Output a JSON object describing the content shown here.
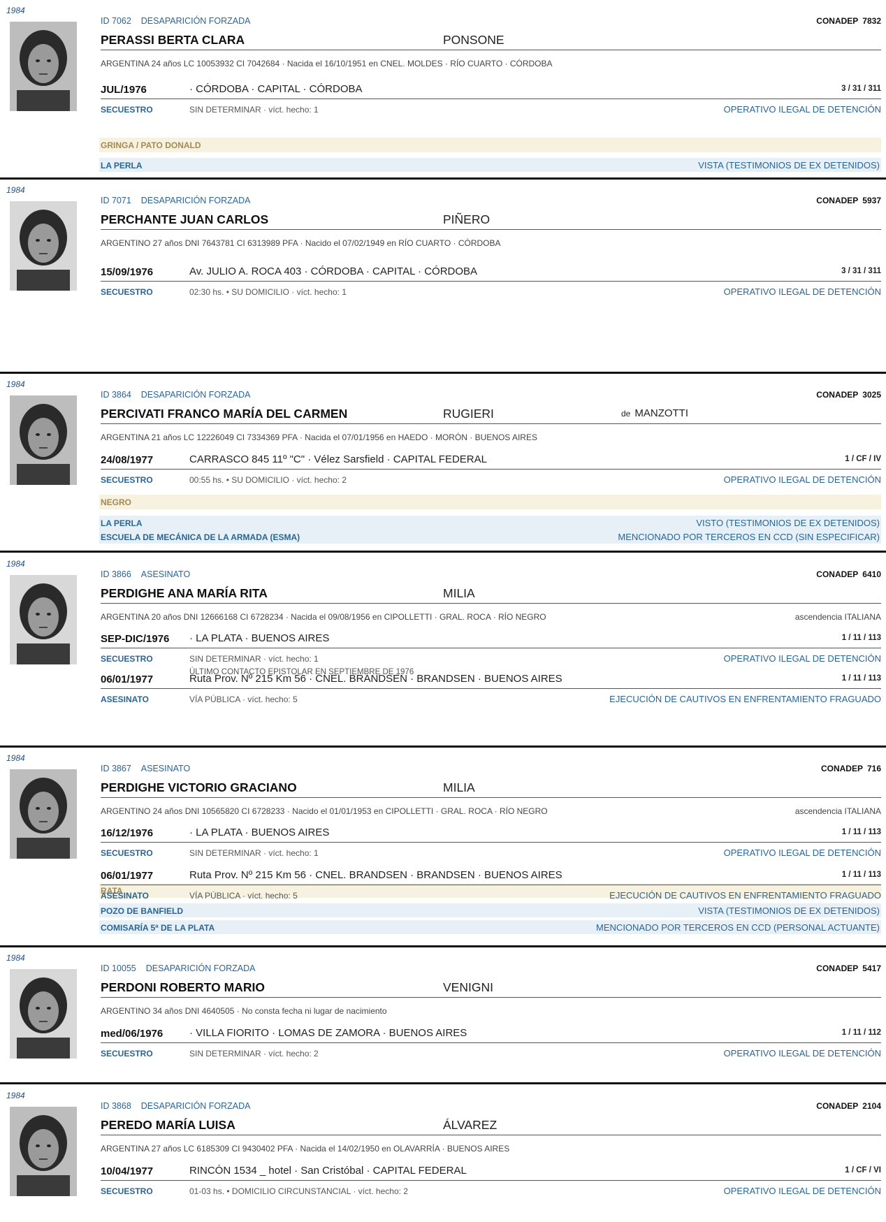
{
  "records": [
    {
      "year": "1984",
      "id": "ID 7062",
      "category": "DESAPARICIÓN FORZADA",
      "conadep_label": "CONADEP",
      "conadep_number": "7832",
      "surname_given": "PERASSI  BERTA CLARA",
      "mother_surname": "PONSONE",
      "personal": "ARGENTINA   24 años   LC 10053932   CI 7042684  ·  Nacida el 16/10/1951 en CNEL. MOLDES · RÍO CUARTO · CÓRDOBA",
      "events": [
        {
          "date": "JUL/1976",
          "place": "· CÓRDOBA · CAPITAL · CÓRDOBA",
          "code": "3 / 31 / 311",
          "type": "SECUESTRO",
          "detail": "SIN DETERMINAR  ·  víct. hecho: 1",
          "operation": "OPERATIVO ILEGAL DE DETENCIÓN"
        }
      ],
      "alias": "GRINGA / PATO DONALD",
      "ccd": [
        {
          "name": "LA PERLA",
          "status": "VISTA (TESTIMONIOS DE EX DETENIDOS)"
        }
      ]
    },
    {
      "year": "1984",
      "id": "ID 7071",
      "category": "DESAPARICIÓN FORZADA",
      "conadep_label": "CONADEP",
      "conadep_number": "5937",
      "surname_given": "PERCHANTE  JUAN CARLOS",
      "mother_surname": "PIÑERO",
      "personal": "ARGENTINO   27 años   DNI 7643781   CI 6313989 PFA  ·  Nacido el 07/02/1949 en RÍO CUARTO · CÓRDOBA",
      "events": [
        {
          "date": "15/09/1976",
          "place": "Av. JULIO A. ROCA 403   ·   CÓRDOBA · CAPITAL · CÓRDOBA",
          "code": "3 / 31 / 311",
          "type": "SECUESTRO",
          "detail": "02:30 hs.  •  SU DOMICILIO  ·  víct. hecho: 1",
          "operation": "OPERATIVO ILEGAL DE DETENCIÓN"
        }
      ],
      "alias": "NEGRO",
      "ccd": [
        {
          "name": "LA PERLA",
          "status": "VISTO (TESTIMONIOS DE EX DETENIDOS)"
        },
        {
          "name": "ESCUELA DE MECÁNICA DE LA ARMADA (ESMA)",
          "status": "MENCIONADO POR TERCEROS EN CCD (SIN ESPECIFICAR)"
        }
      ]
    },
    {
      "year": "1984",
      "id": "ID 3864",
      "category": "DESAPARICIÓN FORZADA",
      "conadep_label": "CONADEP",
      "conadep_number": "3025",
      "surname_given": "PERCIVATI FRANCO  MARÍA DEL CARMEN",
      "mother_surname": "RUGIERI",
      "spouse_prefix": "de",
      "spouse_surname": "MANZOTTI",
      "personal": "ARGENTINA   21 años   LC 12226049   CI 7334369 PFA  ·  Nacida el 07/01/1956 en HAEDO · MORÓN · BUENOS AIRES",
      "events": [
        {
          "date": "24/08/1977",
          "place": "CARRASCO 845  11º \"C\"  ·  Vélez Sarsfield  ·  CAPITAL FEDERAL",
          "code": "1 / CF / IV",
          "type": "SECUESTRO",
          "detail": "00:55 hs.  •  SU DOMICILIO  ·  víct. hecho: 2",
          "operation": "OPERATIVO ILEGAL DE DETENCIÓN"
        }
      ],
      "alias": "RATA",
      "ccd": [
        {
          "name": "POZO DE BANFIELD",
          "status": "VISTA (TESTIMONIOS DE EX DETENIDOS)"
        }
      ]
    },
    {
      "year": "1984",
      "id": "ID 3866",
      "category": "ASESINATO",
      "conadep_label": "CONADEP",
      "conadep_number": "6410",
      "surname_given": "PERDIGHE  ANA MARÍA RITA",
      "mother_surname": "MILIA",
      "personal": "ARGENTINA   20 años   DNI 12666168   CI 6728234  ·  Nacida el 09/08/1956 en CIPOLLETTI · GRAL. ROCA · RÍO NEGRO",
      "ancestry": "ascendencia ITALIANA",
      "events": [
        {
          "date": "SEP-DIC/1976",
          "place": "· LA PLATA · BUENOS AIRES",
          "code": "1 / 11 / 113",
          "type": "SECUESTRO",
          "detail": "SIN DETERMINAR  ·  víct. hecho: 1",
          "note": "ÚLTIMO CONTACTO EPISTOLAR EN SEPTIEMBRE DE 1976",
          "operation": "OPERATIVO ILEGAL DE DETENCIÓN"
        },
        {
          "date": "06/01/1977",
          "place": "Ruta Prov. Nº 215  Km 56   ·   CNEL. BRANDSEN · BRANDSEN · BUENOS AIRES",
          "code": "1 / 11 / 113",
          "type": "ASESINATO",
          "detail": "VÍA PÚBLICA  ·  víct. hecho: 5",
          "operation": "EJECUCIÓN DE CAUTIVOS EN ENFRENTAMIENTO FRAGUADO"
        }
      ],
      "ccd": []
    },
    {
      "year": "1984",
      "id": "ID 3867",
      "category": "ASESINATO",
      "conadep_label": "CONADEP",
      "conadep_number": "716",
      "surname_given": "PERDIGHE  VICTORIO GRACIANO",
      "mother_surname": "MILIA",
      "personal": "ARGENTINO   24 años   DNI 10565820   CI 6728233  ·  Nacido el 01/01/1953 en CIPOLLETTI · GRAL. ROCA · RÍO NEGRO",
      "ancestry": "ascendencia ITALIANA",
      "events": [
        {
          "date": "16/12/1976",
          "place": "· LA PLATA · BUENOS AIRES",
          "code": "1 / 11 / 113",
          "type": "SECUESTRO",
          "detail": "SIN DETERMINAR  ·  víct. hecho: 1",
          "operation": "OPERATIVO ILEGAL DE DETENCIÓN"
        },
        {
          "date": "06/01/1977",
          "place": "Ruta Prov. Nº 215  Km 56   ·   CNEL. BRANDSEN · BRANDSEN · BUENOS AIRES",
          "code": "1 / 11 / 113",
          "type": "ASESINATO",
          "detail": "VÍA PÚBLICA  ·  víct. hecho: 5",
          "operation": "EJECUCIÓN DE CAUTIVOS EN ENFRENTAMIENTO FRAGUADO"
        }
      ],
      "ccd": [
        {
          "name": "COMISARÍA 5ª DE LA PLATA",
          "status": "MENCIONADO POR TERCEROS EN CCD (PERSONAL ACTUANTE)"
        }
      ]
    },
    {
      "year": "1984",
      "id": "ID 10055",
      "category": "DESAPARICIÓN FORZADA",
      "conadep_label": "CONADEP",
      "conadep_number": "5417",
      "surname_given": "PERDONI  ROBERTO MARIO",
      "mother_surname": "VENIGNI",
      "personal": "ARGENTINO   34 años   DNI 4640505  ·  No consta fecha ni lugar de nacimiento",
      "events": [
        {
          "date": "med/06/1976",
          "place": "· VILLA FIORITO · LOMAS DE ZAMORA · BUENOS AIRES",
          "code": "1 / 11 / 112",
          "type": "SECUESTRO",
          "detail": "SIN DETERMINAR  ·  víct. hecho: 2",
          "operation": "OPERATIVO ILEGAL DE DETENCIÓN"
        }
      ],
      "ccd": []
    },
    {
      "year": "1984",
      "id": "ID 3868",
      "category": "DESAPARICIÓN FORZADA",
      "conadep_label": "CONADEP",
      "conadep_number": "2104",
      "surname_given": "PEREDO  MARÍA LUISA",
      "mother_surname": "ÁLVAREZ",
      "personal": "ARGENTINA   27 años   LC 6185309   CI 9430402 PFA  ·  Nacida el 14/02/1950 en OLAVARRÍA · BUENOS AIRES",
      "events": [
        {
          "date": "10/04/1977",
          "place": "RINCÓN 1534 _ hotel  ·  San Cristóbal  ·  CAPITAL FEDERAL",
          "code": "1 / CF / VI",
          "type": "SECUESTRO",
          "detail": "01-03 hs.  •  DOMICILIO CIRCUNSTANCIAL  ·  víct. hecho: 2",
          "operation": "OPERATIVO ILEGAL DE DETENCIÓN"
        }
      ],
      "ccd": []
    }
  ]
}
